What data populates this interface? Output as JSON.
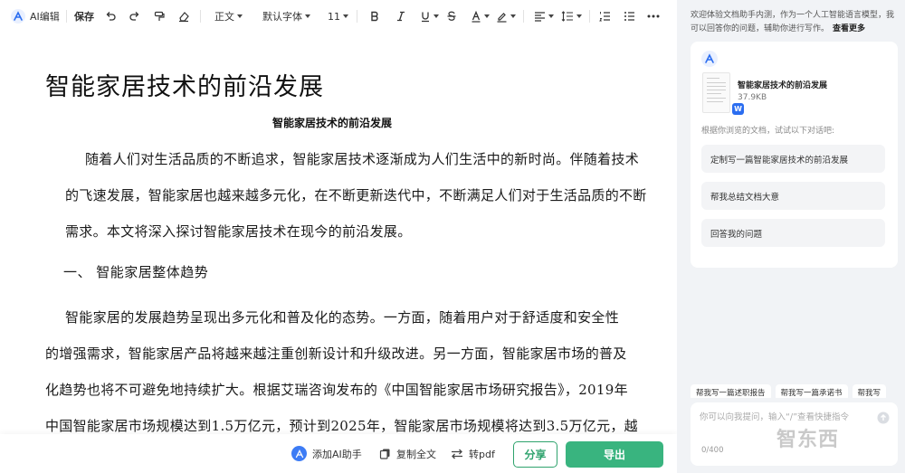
{
  "toolbar": {
    "brand_label": "AI编辑",
    "save_label": "保存",
    "style_select": "正文",
    "font_select": "默认字体",
    "size_select": "11"
  },
  "document": {
    "title": "智能家居技术的前沿发展",
    "subtitle": "智能家居技术的前沿发展",
    "para1": [
      "随着人们对生活品质的不断追求，智能家居技术逐渐成为人们生活中的新时尚。伴随着技术",
      "的飞速发展，智能家居也越来越多元化，在不断更新迭代中，不断满足人们对于生活品质的不断",
      "需求。本文将深入探讨智能家居技术在现今的前沿发展。"
    ],
    "heading1": "一、 智能家居整体趋势",
    "para2": [
      "智能家居的发展趋势呈现出多元化和普及化的态势。一方面，随着用户对于舒适度和安全性",
      "的增强需求，智能家居产品将越来越注重创新设计和升级改进。另一方面，智能家居市场的普及",
      "化趋势也将不可避免地持续扩大。根据艾瑞咨询发布的《中国智能家居市场研究报告》，2019年",
      "中国智能家居市场规模达到1.5万亿元，预计到2025年，智能家居市场规模将达到3.5万亿元，越"
    ]
  },
  "bottombar": {
    "add_ai_label": "添加AI助手",
    "copy_label": "复制全文",
    "pdf_label": "转pdf",
    "share_label": "分享",
    "export_label": "导出"
  },
  "panel": {
    "welcome_text": "欢迎体验文档助手内测，作为一个人工智能语言模型，我可以回答你的问题，辅助你进行写作。",
    "more_label": "查看更多",
    "file": {
      "name": "智能家居技术的前沿发展",
      "size": "37.9KB",
      "badge": "W"
    },
    "hint": "根据你浏览的文档，试试以下对话吧:",
    "suggestions": [
      "定制写一篇智能家居技术的前沿发展",
      "帮我总结文档大意",
      "回答我的问题"
    ],
    "chips": [
      "帮我写一篇述职报告",
      "帮我写一篇承诺书",
      "帮我写"
    ],
    "input_placeholder": "你可以向我提问，输入“/”查看快捷指令",
    "counter": "0/400",
    "watermark": "智东西"
  },
  "colors": {
    "accent_green": "#39b47f",
    "accent_blue": "#2b6df0",
    "panel_bg": "#f1f3f6"
  }
}
